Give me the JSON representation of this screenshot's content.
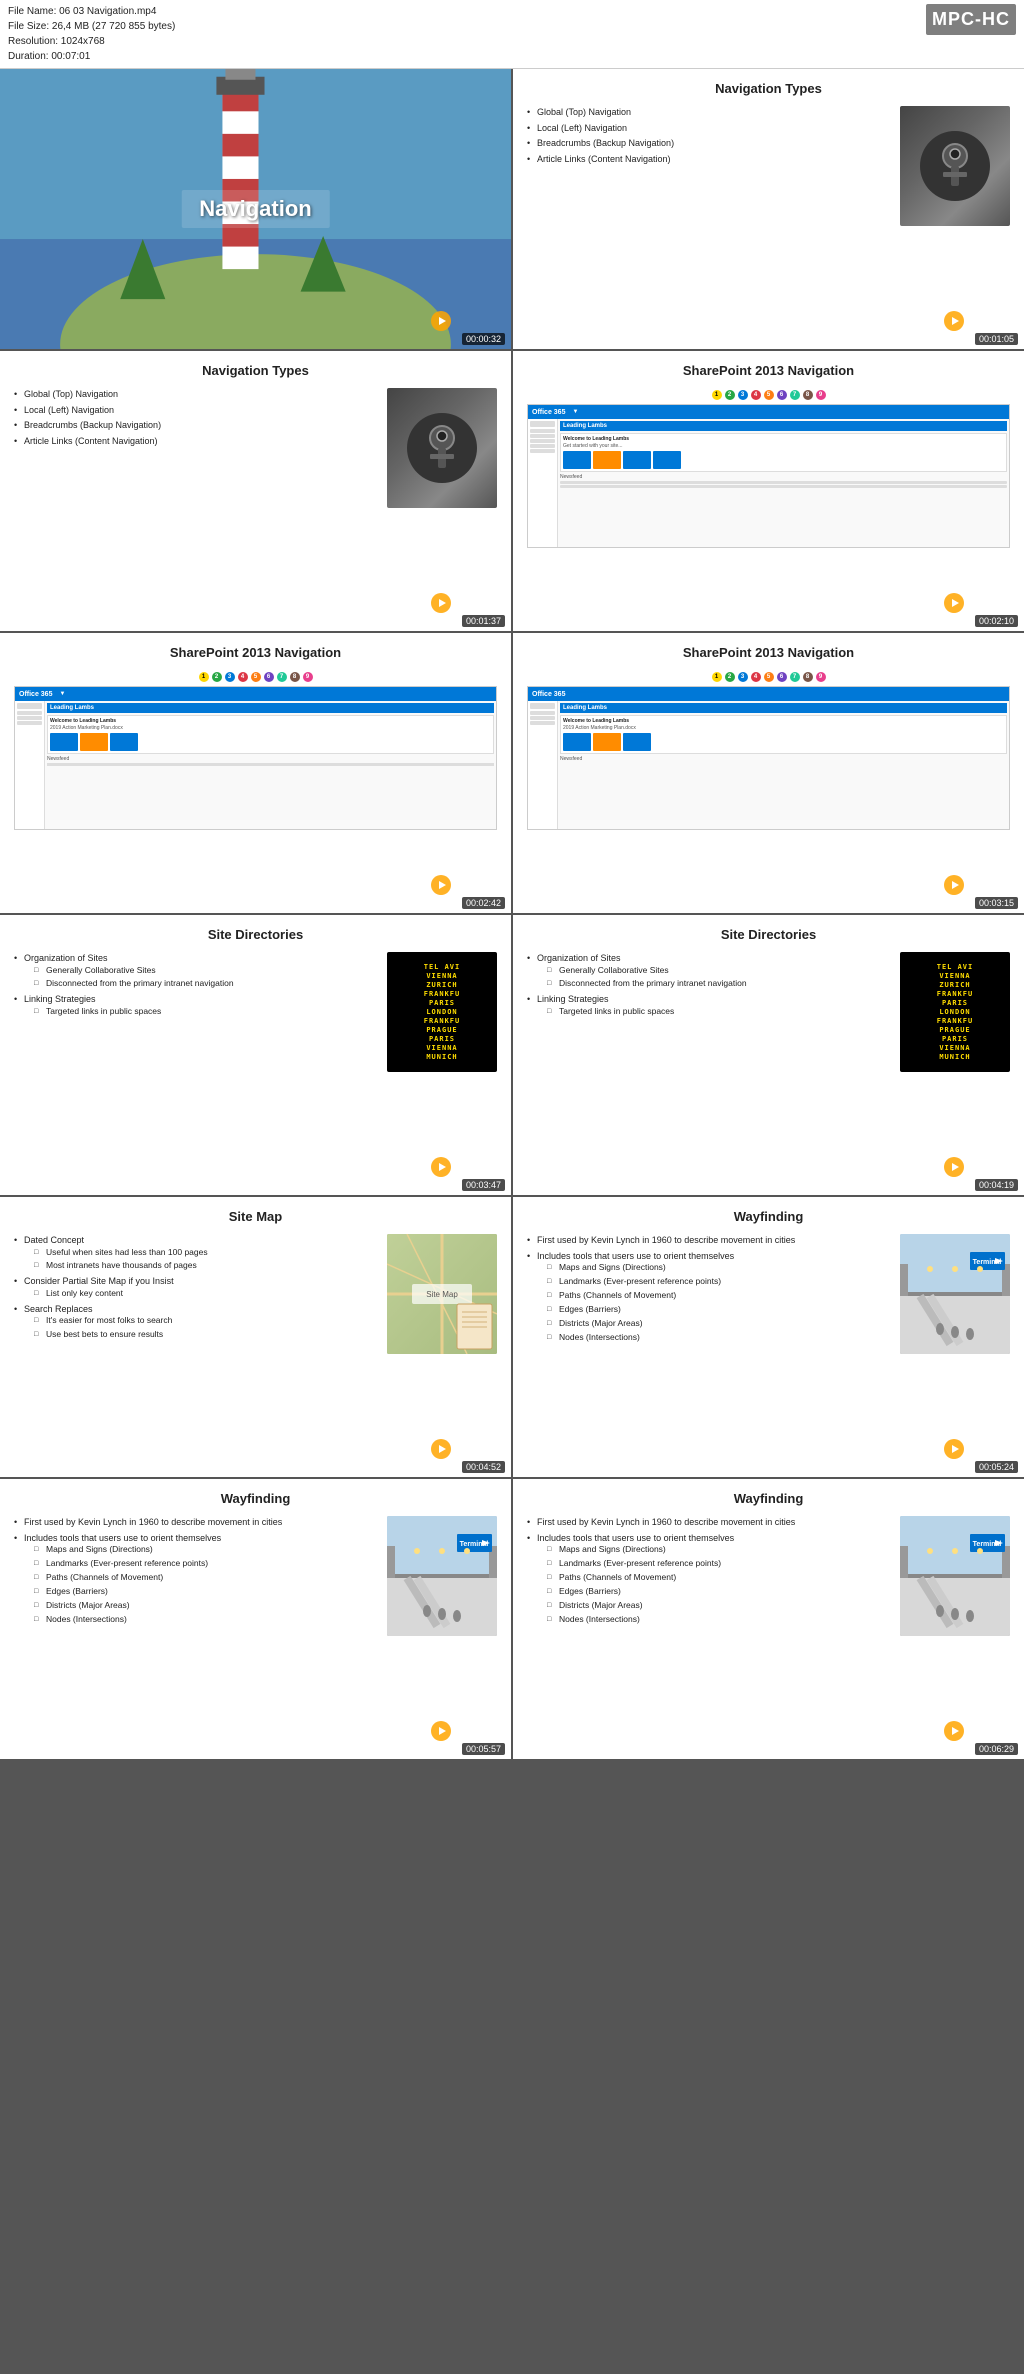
{
  "fileinfo": {
    "filename": "File Name: 06 03 Navigation.mp4",
    "filesize": "File Size: 26,4 MB (27 720 855 bytes)",
    "resolution": "Resolution: 1024x768",
    "duration": "Duration: 00:07:01"
  },
  "badge": "MPC-HC",
  "slides": [
    {
      "id": "slide-1",
      "type": "hero",
      "title": "Navigation",
      "timestamp": "00:00:32"
    },
    {
      "id": "slide-2",
      "type": "bullets-image",
      "title": "Navigation Types",
      "bullets": [
        {
          "text": "Global (Top) Navigation",
          "sub": []
        },
        {
          "text": "Local (Left) Navigation",
          "sub": []
        },
        {
          "text": "Breadcrumbs (Backup Navigation)",
          "sub": []
        },
        {
          "text": "Article Links (Content Navigation)",
          "sub": []
        }
      ],
      "image": "carkeys",
      "timestamp": "00:01:05"
    },
    {
      "id": "slide-3",
      "type": "bullets-image",
      "title": "Navigation Types",
      "bullets": [
        {
          "text": "Global (Top) Navigation",
          "sub": []
        },
        {
          "text": "Local (Left) Navigation",
          "sub": []
        },
        {
          "text": "Breadcrumbs (Backup Navigation)",
          "sub": []
        },
        {
          "text": "Article Links (Content Navigation)",
          "sub": []
        }
      ],
      "image": "carkeys",
      "timestamp": "00:01:37"
    },
    {
      "id": "slide-4",
      "type": "sharepoint",
      "title": "SharePoint 2013 Navigation",
      "timestamp": "00:02:10"
    },
    {
      "id": "slide-5",
      "type": "sharepoint",
      "title": "SharePoint 2013 Navigation",
      "timestamp": "00:02:42"
    },
    {
      "id": "slide-6",
      "type": "sharepoint",
      "title": "SharePoint 2013 Navigation",
      "timestamp": "00:03:15"
    },
    {
      "id": "slide-7",
      "type": "bullets-image",
      "title": "Site Directories",
      "bullets": [
        {
          "text": "Organization of Sites",
          "sub": [
            "Generally Collaborative Sites",
            "Disconnected from the primary intranet navigation"
          ]
        },
        {
          "text": "Linking Strategies",
          "sub": [
            "Targeted links in public spaces"
          ]
        }
      ],
      "image": "departures",
      "timestamp": "00:03:47"
    },
    {
      "id": "slide-8",
      "type": "bullets-image",
      "title": "Site Directories",
      "bullets": [
        {
          "text": "Organization of Sites",
          "sub": [
            "Generally Collaborative Sites",
            "Disconnected from the primary intranet navigation"
          ]
        },
        {
          "text": "Linking Strategies",
          "sub": [
            "Targeted links in public spaces"
          ]
        }
      ],
      "image": "departures",
      "timestamp": "00:04:19"
    },
    {
      "id": "slide-9",
      "type": "bullets-image",
      "title": "Site Map",
      "bullets": [
        {
          "text": "Dated Concept",
          "sub": [
            "Useful when sites had less than 100 pages",
            "Most intranets have thousands of pages"
          ]
        },
        {
          "text": "Consider Partial Site Map if you Insist",
          "sub": [
            "List only key content"
          ]
        },
        {
          "text": "Search Replaces",
          "sub": [
            "It's easier for most folks to search",
            "Use best bets to ensure results"
          ]
        }
      ],
      "image": "map",
      "timestamp": "00:04:52"
    },
    {
      "id": "slide-10",
      "type": "bullets-image",
      "title": "Wayfinding",
      "bullets": [
        {
          "text": "First used by Kevin Lynch in 1960 to describe movement in cities",
          "sub": []
        },
        {
          "text": "Includes tools that users use to orient themselves",
          "sub": [
            "Maps and Signs (Directions)",
            "Landmarks (Ever-present reference points)",
            "Paths (Channels of Movement)",
            "Edges (Barriers)",
            "Districts (Major Areas)",
            "Nodes (Intersections)"
          ]
        }
      ],
      "image": "airport",
      "timestamp": "00:05:24"
    },
    {
      "id": "slide-11",
      "type": "bullets-image",
      "title": "Wayfinding",
      "bullets": [
        {
          "text": "First used by Kevin Lynch in 1960 to describe movement in cities",
          "sub": []
        },
        {
          "text": "Includes tools that users use to orient themselves",
          "sub": [
            "Maps and Signs (Directions)",
            "Landmarks (Ever-present reference points)",
            "Paths (Channels of Movement)",
            "Edges (Barriers)",
            "Districts (Major Areas)",
            "Nodes (Intersections)"
          ]
        }
      ],
      "image": "airport",
      "timestamp": "00:05:57"
    },
    {
      "id": "slide-12",
      "type": "bullets-image",
      "title": "Wayfinding",
      "bullets": [
        {
          "text": "First used by Kevin Lynch in 1960 to describe movement in cities",
          "sub": []
        },
        {
          "text": "Includes tools that users use to orient themselves",
          "sub": [
            "Maps and Signs (Directions)",
            "Landmarks (Ever-present reference points)",
            "Paths (Channels of Movement)",
            "Edges (Barriers)",
            "Districts (Major Areas)",
            "Nodes (Intersections)"
          ]
        }
      ],
      "image": "airport",
      "timestamp": "00:06:29"
    }
  ],
  "departures": [
    "TEL AVI",
    "VIENNA",
    "ZURICH",
    "FRANKFU",
    "PARIS",
    "LONDON",
    "FRANKFU",
    "PRAGUE",
    "PARIS",
    "VIENNA",
    "MUNICH"
  ]
}
